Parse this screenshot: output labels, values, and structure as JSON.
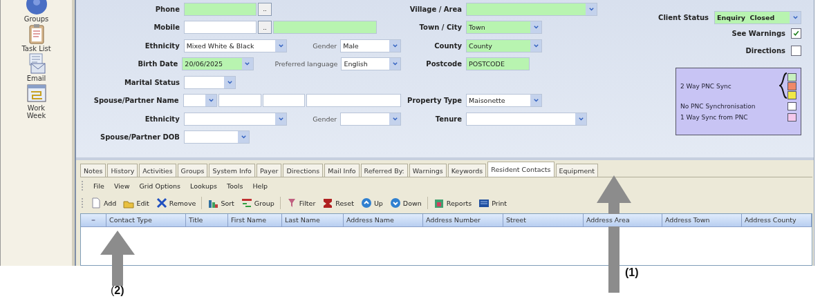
{
  "sidebar": {
    "items": [
      {
        "label": "Groups",
        "kind": "globe"
      },
      {
        "label": "Task List",
        "kind": "clipboard"
      },
      {
        "label": "Email",
        "kind": "mail"
      },
      {
        "label": "Work Week",
        "kind": "calendar"
      }
    ]
  },
  "form": {
    "left_rows": [
      {
        "items": [
          {
            "kind": "label",
            "text": "Phone"
          },
          {
            "kind": "text",
            "required": true
          },
          {
            "kind": "button",
            "text": ".."
          }
        ]
      },
      {
        "items": [
          {
            "kind": "label",
            "text": "Mobile"
          },
          {
            "kind": "text",
            "required": false
          },
          {
            "kind": "button",
            "text": ".."
          },
          {
            "kind": "text",
            "required": true
          }
        ]
      },
      {
        "items": [
          {
            "kind": "label",
            "text": "Ethnicity"
          },
          {
            "kind": "select",
            "value": "Mixed White & Black",
            "required": false
          },
          {
            "kind": "sublabel",
            "text": "Gender"
          },
          {
            "kind": "select",
            "value": "Male",
            "required": false
          }
        ]
      },
      {
        "items": [
          {
            "kind": "label",
            "text": "Birth Date"
          },
          {
            "kind": "select",
            "value": "20/06/2025",
            "required": true
          },
          {
            "kind": "sublabel",
            "text": "Preferred language"
          },
          {
            "kind": "select",
            "value": "English",
            "required": false
          }
        ]
      },
      {
        "items": [
          {
            "kind": "label",
            "text": "Marital Status"
          },
          {
            "kind": "select",
            "required": false
          }
        ]
      },
      {
        "items": [
          {
            "kind": "label",
            "text": "Spouse/Partner Name"
          },
          {
            "kind": "select",
            "required": false
          },
          {
            "kind": "text",
            "required": false
          },
          {
            "kind": "text",
            "required": false
          },
          {
            "kind": "text",
            "required": false
          }
        ]
      },
      {
        "items": [
          {
            "kind": "label",
            "text": "Ethnicity"
          },
          {
            "kind": "select",
            "required": false
          },
          {
            "kind": "sublabel",
            "text": "Gender"
          },
          {
            "kind": "select",
            "required": false
          }
        ]
      },
      {
        "items": [
          {
            "kind": "label",
            "text": "Spouse/Partner DOB"
          },
          {
            "kind": "select",
            "required": false
          }
        ]
      }
    ],
    "middle_rows": [
      {
        "items": [
          {
            "kind": "label",
            "text": "Village / Area"
          },
          {
            "kind": "select",
            "required": true
          }
        ]
      },
      {
        "items": [
          {
            "kind": "label",
            "text": "Town / City"
          },
          {
            "kind": "select",
            "value": "Town",
            "required": true
          }
        ]
      },
      {
        "items": [
          {
            "kind": "label",
            "text": "County"
          },
          {
            "kind": "select",
            "value": "County",
            "required": true
          }
        ]
      },
      {
        "items": [
          {
            "kind": "label",
            "text": "Postcode"
          },
          {
            "kind": "text",
            "value": "POSTCODE",
            "required": true
          }
        ]
      },
      {
        "items": []
      },
      {
        "items": [
          {
            "kind": "label",
            "text": "Property Type"
          },
          {
            "kind": "select",
            "value": "Maisonette",
            "required": false
          }
        ]
      },
      {
        "items": [
          {
            "kind": "label",
            "text": "Tenure"
          },
          {
            "kind": "select",
            "required": false
          }
        ]
      }
    ]
  },
  "client_status": {
    "label": "Client Status",
    "value": "Enquiry  Closed"
  },
  "checkboxes": [
    {
      "label": "See Warnings",
      "checked": true
    },
    {
      "label": "Directions",
      "checked": false
    }
  ],
  "legend": {
    "sync": {
      "label": "2 Way PNC Sync",
      "swatches": [
        {
          "color": "#c8f0c0"
        },
        {
          "color": "#f08868"
        },
        {
          "color": "#f0e848"
        }
      ]
    },
    "items": [
      {
        "label": "No PNC Synchronisation",
        "color": "#ffffff"
      },
      {
        "label": "1 Way Sync from PNC",
        "color": "#f4c8ec"
      }
    ]
  },
  "tabs": [
    {
      "label": "Notes",
      "selected": false
    },
    {
      "label": "History",
      "selected": false
    },
    {
      "label": "Activities",
      "selected": false
    },
    {
      "label": "Groups",
      "selected": false
    },
    {
      "label": "System Info",
      "selected": false
    },
    {
      "label": "Payer",
      "selected": false
    },
    {
      "label": "Directions",
      "selected": false
    },
    {
      "label": "Mail Info",
      "selected": false
    },
    {
      "label": "Referred By:",
      "selected": false
    },
    {
      "label": "Warnings",
      "selected": false
    },
    {
      "label": "Keywords",
      "selected": false
    },
    {
      "label": "Resident Contacts",
      "selected": true
    },
    {
      "label": "Equipment",
      "selected": false
    }
  ],
  "menu": [
    "File",
    "View",
    "Grid Options",
    "Lookups",
    "Tools",
    "Help"
  ],
  "toolbar": [
    [
      {
        "label": "Add",
        "kind": "add"
      },
      {
        "label": "Edit",
        "kind": "edit"
      },
      {
        "label": "Remove",
        "kind": "remove"
      }
    ],
    [
      {
        "label": "Sort",
        "kind": "sort"
      },
      {
        "label": "Group",
        "kind": "group"
      }
    ],
    [
      {
        "label": "Filter",
        "kind": "filter"
      },
      {
        "label": "Reset",
        "kind": "reset"
      },
      {
        "label": "Up",
        "kind": "up"
      },
      {
        "label": "Down",
        "kind": "down"
      }
    ],
    [
      {
        "label": "Reports",
        "kind": "reports"
      },
      {
        "label": "Print",
        "kind": "print"
      }
    ]
  ],
  "table": {
    "columns": [
      "Contact Type",
      "Title",
      "First Name",
      "Last Name",
      "Address Name",
      "Address Number",
      "Street",
      "Address Area",
      "Address Town",
      "Address County"
    ]
  },
  "annotations": [
    {
      "label": "(1)"
    },
    {
      "label": "(**2)**"
    }
  ]
}
